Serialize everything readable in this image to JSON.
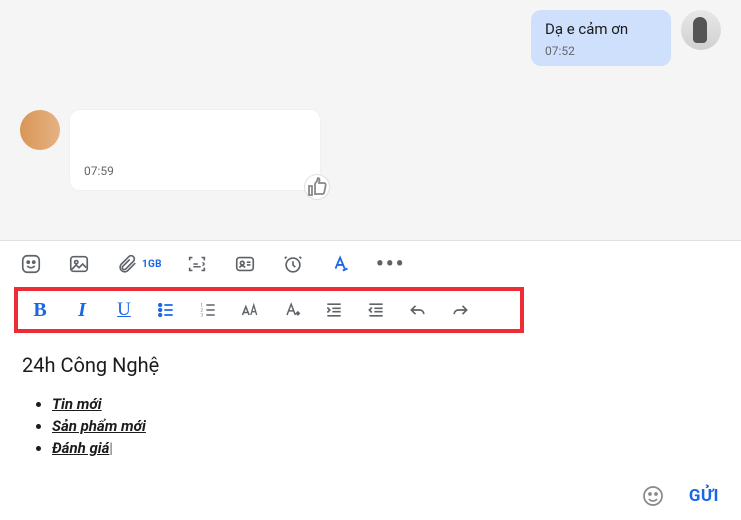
{
  "chat": {
    "out": {
      "text": "Dạ e cảm ơn",
      "time": "07:52"
    },
    "in": {
      "time": "07:59"
    }
  },
  "toolbar": {
    "attach_label": "1GB"
  },
  "format": {
    "bold": "B",
    "italic": "I",
    "underline": "U"
  },
  "editor": {
    "title": "24h Công Nghệ",
    "items": [
      "Tin mới",
      "Sản phẩm mới",
      "Đánh giá"
    ]
  },
  "footer": {
    "send": "GỬI"
  }
}
